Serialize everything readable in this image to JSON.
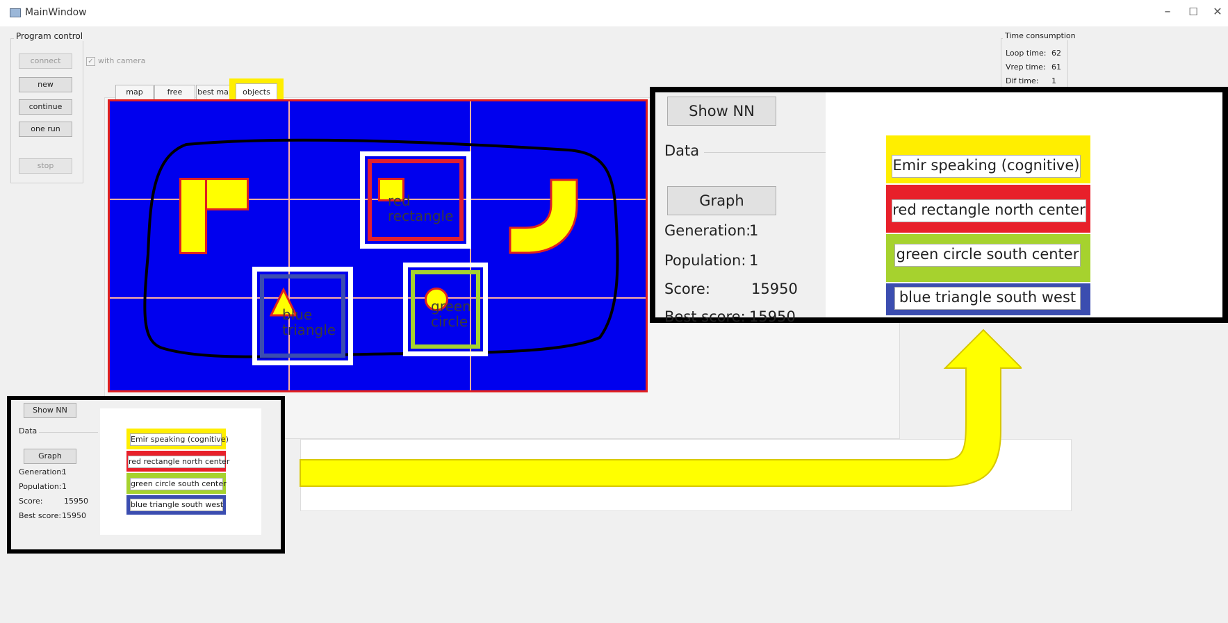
{
  "window": {
    "title": "MainWindow",
    "minimize": "–",
    "maximize": "☐",
    "close": "✕"
  },
  "program_control": {
    "label": "Program control",
    "connect": "connect",
    "with_camera": "with camera",
    "with_camera_checked": true,
    "new": "new",
    "continue": "continue",
    "one_run": "one run",
    "stop": "stop"
  },
  "time_consumption": {
    "label": "Time consumption",
    "loop_label": "Loop time:",
    "loop_value": "62",
    "vrep_label": "Vrep time:",
    "vrep_value": "61",
    "dif_label": "Dif time:",
    "dif_value": "1"
  },
  "tabs": [
    {
      "label": "map"
    },
    {
      "label": "free space"
    },
    {
      "label": "best map"
    },
    {
      "label": "objects",
      "active": true
    }
  ],
  "map_objects": {
    "red": "red\nrectangle",
    "blue": "blue\ntriangle",
    "green": "green\ncircle"
  },
  "panel": {
    "show_nn": "Show NN",
    "data_label": "Data",
    "graph": "Graph",
    "generation_label": "Generation:",
    "generation": "1",
    "population_label": "Population:",
    "population": "1",
    "score_label": "Score:",
    "score": "15950",
    "best_label": "Best score:",
    "best": "15950"
  },
  "classification": [
    {
      "text": "Emir speaking (cognitive)",
      "color": "#ffee00"
    },
    {
      "text": "red rectangle north center",
      "color": "#e8202a"
    },
    {
      "text": "green circle south center",
      "color": "#a6d22e"
    },
    {
      "text": "blue triangle south west",
      "color": "#3b4db0"
    }
  ],
  "colors": {
    "map_bg": "#0000ee",
    "object": "#ffff00",
    "border": "#e02020",
    "arrow": "#ffff00"
  }
}
